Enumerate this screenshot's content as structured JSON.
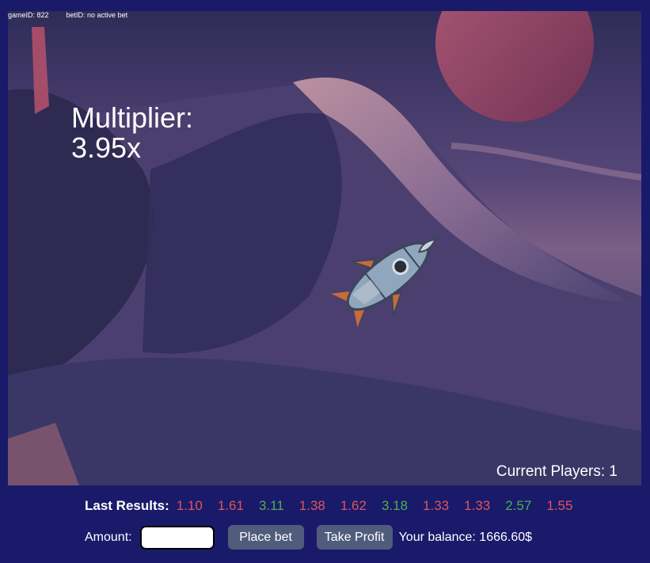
{
  "header": {
    "game_id": "gameID: 822",
    "bet_id": "betID: no active bet"
  },
  "game": {
    "multiplier_label": "Multiplier:",
    "multiplier_value": "3.95x",
    "current_players": "Current Players: 1",
    "rocket_icon": "rocket-icon"
  },
  "results": {
    "label": "Last Results:",
    "items": [
      {
        "value": "1.10",
        "color": "#e05555"
      },
      {
        "value": "1.61",
        "color": "#e05555"
      },
      {
        "value": "3.11",
        "color": "#4caf50"
      },
      {
        "value": "1.38",
        "color": "#e05555"
      },
      {
        "value": "1.62",
        "color": "#e05555"
      },
      {
        "value": "3.18",
        "color": "#4caf50"
      },
      {
        "value": "1.33",
        "color": "#e05555"
      },
      {
        "value": "1.33",
        "color": "#e05555"
      },
      {
        "value": "2.57",
        "color": "#4caf50"
      },
      {
        "value": "1.55",
        "color": "#e05555"
      }
    ]
  },
  "controls": {
    "amount_label": "Amount:",
    "amount_value": "",
    "place_bet_label": "Place bet",
    "take_profit_label": "Take Profit",
    "balance_text": "Your balance: 1666.60$"
  },
  "colors": {
    "page_bg": "#1a1a6b",
    "button_bg": "#4f5c7c",
    "loss": "#e05555",
    "win": "#4caf50"
  }
}
